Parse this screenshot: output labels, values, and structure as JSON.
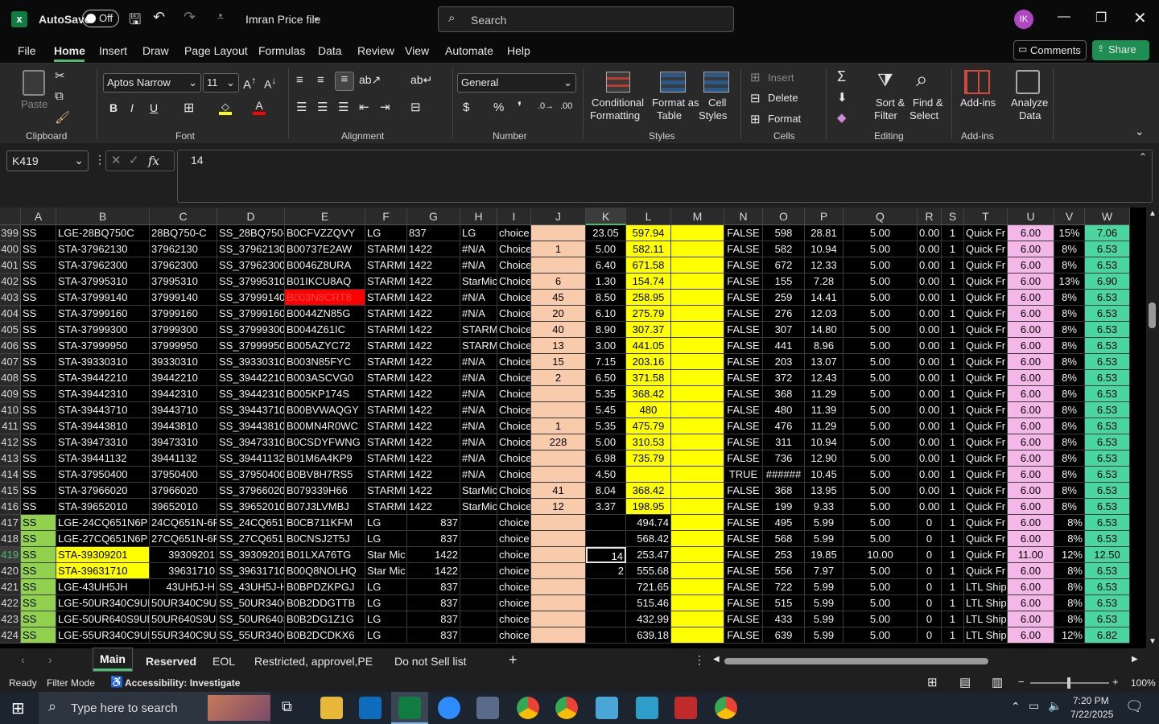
{
  "title_bar": {
    "autosave_label": "AutoSave",
    "autosave_state": "Off",
    "file_name": "Imran Price file",
    "search_placeholder": "Search",
    "avatar_initials": "IK"
  },
  "menu": {
    "items": [
      "File",
      "Home",
      "Insert",
      "Draw",
      "Page Layout",
      "Formulas",
      "Data",
      "Review",
      "View",
      "Automate",
      "Help"
    ],
    "active": "Home",
    "comments_label": "Comments",
    "share_label": "Share"
  },
  "ribbon": {
    "clipboard": {
      "paste": "Paste",
      "label": "Clipboard"
    },
    "font": {
      "name": "Aptos Narrow",
      "size": "11",
      "label": "Font"
    },
    "alignment": {
      "label": "Alignment"
    },
    "number": {
      "format": "General",
      "label": "Number"
    },
    "styles": {
      "conditional_1": "Conditional",
      "conditional_2": "Formatting",
      "format_table_1": "Format as",
      "format_table_2": "Table",
      "cell_styles_1": "Cell",
      "cell_styles_2": "Styles",
      "label": "Styles"
    },
    "cells": {
      "insert": "Insert",
      "delete": "Delete",
      "format": "Format",
      "label": "Cells"
    },
    "editing": {
      "sort_1": "Sort &",
      "sort_2": "Filter",
      "find_1": "Find &",
      "find_2": "Select",
      "label": "Editing"
    },
    "addins": {
      "addins": "Add-ins",
      "analyze_1": "Analyze",
      "analyze_2": "Data",
      "label": "Add-ins"
    }
  },
  "formula_bar": {
    "name_box": "K419",
    "fx": "fx",
    "value": "14"
  },
  "columns": [
    "A",
    "B",
    "C",
    "D",
    "E",
    "F",
    "G",
    "H",
    "I",
    "J",
    "K",
    "L",
    "M",
    "N",
    "O",
    "P",
    "Q",
    "R",
    "S",
    "T",
    "U",
    "V",
    "W"
  ],
  "rows": [
    {
      "n": "399",
      "A": "SS",
      "B": "LGE-28BQ750C",
      "C": "28BQ750-C",
      "D": "SS_28BQ750-C",
      "E": "B0CFVZZQVY",
      "F": "LG",
      "G": "837",
      "H": "LG",
      "I": "choice",
      "J": "",
      "K": "23.05",
      "L": "597.94",
      "M": "",
      "N": "FALSE",
      "O": "598",
      "P": "28.81",
      "Q": "5.00",
      "R": "0.00",
      "S": "1",
      "T": "Quick Fr",
      "U": "6.00",
      "V": "15%",
      "W": "7.06"
    },
    {
      "n": "400",
      "A": "SS",
      "B": "STA-37962130",
      "C": "37962130",
      "D": "SS_37962130",
      "E": "B00737E2AW",
      "F": "STARMI",
      "G": "1422",
      "H": "#N/A",
      "I": "Choice",
      "J": "1",
      "K": "5.00",
      "L": "582.11",
      "M": "",
      "N": "FALSE",
      "O": "582",
      "P": "10.94",
      "Q": "5.00",
      "R": "0.00",
      "S": "1",
      "T": "Quick Fr",
      "U": "6.00",
      "V": "8%",
      "W": "6.53"
    },
    {
      "n": "401",
      "A": "SS",
      "B": "STA-37962300",
      "C": "37962300",
      "D": "SS_37962300",
      "E": "B0046Z8URA",
      "F": "STARMI",
      "G": "1422",
      "H": "#N/A",
      "I": "Choice",
      "J": "",
      "K": "6.40",
      "L": "671.58",
      "M": "",
      "N": "FALSE",
      "O": "672",
      "P": "12.33",
      "Q": "5.00",
      "R": "0.00",
      "S": "1",
      "T": "Quick Fr",
      "U": "6.00",
      "V": "8%",
      "W": "6.53"
    },
    {
      "n": "402",
      "A": "SS",
      "B": "STA-37995310",
      "C": "37995310",
      "D": "SS_37995310",
      "E": "B01IKCU8AQ",
      "F": "STARMI",
      "G": "1422",
      "H": "StarMic",
      "I": "Choice",
      "J": "6",
      "K": "1.30",
      "L": "154.74",
      "M": "",
      "N": "FALSE",
      "O": "155",
      "P": "7.28",
      "Q": "5.00",
      "R": "0.00",
      "S": "1",
      "T": "Quick Fr",
      "U": "6.00",
      "V": "13%",
      "W": "6.90"
    },
    {
      "n": "403",
      "A": "SS",
      "B": "STA-37999140",
      "C": "37999140",
      "D": "SS_37999140",
      "E": "B003N8CRT8",
      "F": "STARMI",
      "G": "1422",
      "H": "#N/A",
      "I": "Choice",
      "J": "45",
      "K": "8.50",
      "L": "258.95",
      "M": "",
      "N": "FALSE",
      "O": "259",
      "P": "14.41",
      "Q": "5.00",
      "R": "0.00",
      "S": "1",
      "T": "Quick Fr",
      "U": "6.00",
      "V": "8%",
      "W": "6.53"
    },
    {
      "n": "404",
      "A": "SS",
      "B": "STA-37999160",
      "C": "37999160",
      "D": "SS_37999160",
      "E": "B0044ZN85G",
      "F": "STARMI",
      "G": "1422",
      "H": "#N/A",
      "I": "Choice",
      "J": "20",
      "K": "6.10",
      "L": "275.79",
      "M": "",
      "N": "FALSE",
      "O": "276",
      "P": "12.03",
      "Q": "5.00",
      "R": "0.00",
      "S": "1",
      "T": "Quick Fr",
      "U": "6.00",
      "V": "8%",
      "W": "6.53"
    },
    {
      "n": "405",
      "A": "SS",
      "B": "STA-37999300",
      "C": "37999300",
      "D": "SS_37999300",
      "E": "B0044Z61IC",
      "F": "STARMI",
      "G": "1422",
      "H": "STARM",
      "I": "Choice",
      "J": "40",
      "K": "8.90",
      "L": "307.37",
      "M": "",
      "N": "FALSE",
      "O": "307",
      "P": "14.80",
      "Q": "5.00",
      "R": "0.00",
      "S": "1",
      "T": "Quick Fr",
      "U": "6.00",
      "V": "8%",
      "W": "6.53"
    },
    {
      "n": "406",
      "A": "SS",
      "B": "STA-37999950",
      "C": "37999950",
      "D": "SS_37999950",
      "E": "B005AZYC72",
      "F": "STARMI",
      "G": "1422",
      "H": "STARM",
      "I": "Choice",
      "J": "13",
      "K": "3.00",
      "L": "441.05",
      "M": "",
      "N": "FALSE",
      "O": "441",
      "P": "8.96",
      "Q": "5.00",
      "R": "0.00",
      "S": "1",
      "T": "Quick Fr",
      "U": "6.00",
      "V": "8%",
      "W": "6.53"
    },
    {
      "n": "407",
      "A": "SS",
      "B": "STA-39330310",
      "C": "39330310",
      "D": "SS_39330310",
      "E": "B003N85FYC",
      "F": "STARMI",
      "G": "1422",
      "H": "#N/A",
      "I": "Choice",
      "J": "15",
      "K": "7.15",
      "L": "203.16",
      "M": "",
      "N": "FALSE",
      "O": "203",
      "P": "13.07",
      "Q": "5.00",
      "R": "0.00",
      "S": "1",
      "T": "Quick Fr",
      "U": "6.00",
      "V": "8%",
      "W": "6.53"
    },
    {
      "n": "408",
      "A": "SS",
      "B": "STA-39442210",
      "C": "39442210",
      "D": "SS_39442210",
      "E": "B003ASCVG0",
      "F": "STARMI",
      "G": "1422",
      "H": "#N/A",
      "I": "Choice",
      "J": "2",
      "K": "6.50",
      "L": "371.58",
      "M": "",
      "N": "FALSE",
      "O": "372",
      "P": "12.43",
      "Q": "5.00",
      "R": "0.00",
      "S": "1",
      "T": "Quick Fr",
      "U": "6.00",
      "V": "8%",
      "W": "6.53"
    },
    {
      "n": "409",
      "A": "SS",
      "B": "STA-39442310",
      "C": "39442310",
      "D": "SS_39442310",
      "E": "B005KP174S",
      "F": "STARMI",
      "G": "1422",
      "H": "#N/A",
      "I": "Choice",
      "J": "",
      "K": "5.35",
      "L": "368.42",
      "M": "",
      "N": "FALSE",
      "O": "368",
      "P": "11.29",
      "Q": "5.00",
      "R": "0.00",
      "S": "1",
      "T": "Quick Fr",
      "U": "6.00",
      "V": "8%",
      "W": "6.53"
    },
    {
      "n": "410",
      "A": "SS",
      "B": "STA-39443710",
      "C": "39443710",
      "D": "SS_39443710",
      "E": "B00BVWAQGY",
      "F": "STARMI",
      "G": "1422",
      "H": "#N/A",
      "I": "Choice",
      "J": "",
      "K": "5.45",
      "L": "480",
      "M": "",
      "N": "FALSE",
      "O": "480",
      "P": "11.39",
      "Q": "5.00",
      "R": "0.00",
      "S": "1",
      "T": "Quick Fr",
      "U": "6.00",
      "V": "8%",
      "W": "6.53"
    },
    {
      "n": "411",
      "A": "SS",
      "B": "STA-39443810",
      "C": "39443810",
      "D": "SS_39443810",
      "E": "B00MN4R0WC",
      "F": "STARMI",
      "G": "1422",
      "H": "#N/A",
      "I": "Choice",
      "J": "1",
      "K": "5.35",
      "L": "475.79",
      "M": "",
      "N": "FALSE",
      "O": "476",
      "P": "11.29",
      "Q": "5.00",
      "R": "0.00",
      "S": "1",
      "T": "Quick Fr",
      "U": "6.00",
      "V": "8%",
      "W": "6.53"
    },
    {
      "n": "412",
      "A": "SS",
      "B": "STA-39473310",
      "C": "39473310",
      "D": "SS_39473310",
      "E": "B0CSDYFWNG",
      "F": "STARMI",
      "G": "1422",
      "H": "#N/A",
      "I": "Choice",
      "J": "228",
      "K": "5.00",
      "L": "310.53",
      "M": "",
      "N": "FALSE",
      "O": "311",
      "P": "10.94",
      "Q": "5.00",
      "R": "0.00",
      "S": "1",
      "T": "Quick Fr",
      "U": "6.00",
      "V": "8%",
      "W": "6.53"
    },
    {
      "n": "413",
      "A": "SS",
      "B": "STA-39441132",
      "C": "39441132",
      "D": "SS_39441132",
      "E": "B01M6A4KP9",
      "F": "STARMI",
      "G": "1422",
      "H": "#N/A",
      "I": "Choice",
      "J": "",
      "K": "6.98",
      "L": "735.79",
      "M": "",
      "N": "FALSE",
      "O": "736",
      "P": "12.90",
      "Q": "5.00",
      "R": "0.00",
      "S": "1",
      "T": "Quick Fr",
      "U": "6.00",
      "V": "8%",
      "W": "6.53"
    },
    {
      "n": "414",
      "A": "SS",
      "B": "STA-37950400",
      "C": "37950400",
      "D": "SS_37950400",
      "E": "B0BV8H7RS5",
      "F": "STARMI",
      "G": "1422",
      "H": "#N/A",
      "I": "Choice",
      "J": "",
      "K": "4.50",
      "L": "",
      "M": "",
      "N": "TRUE",
      "O": "######",
      "P": "10.45",
      "Q": "5.00",
      "R": "0.00",
      "S": "1",
      "T": "Quick Fr",
      "U": "6.00",
      "V": "8%",
      "W": "6.53"
    },
    {
      "n": "415",
      "A": "SS",
      "B": "STA-37966020",
      "C": "37966020",
      "D": "SS_37966020",
      "E": "B079339H66",
      "F": "STARMI",
      "G": "1422",
      "H": "StarMic",
      "I": "Choice",
      "J": "41",
      "K": "8.04",
      "L": "368.42",
      "M": "",
      "N": "FALSE",
      "O": "368",
      "P": "13.95",
      "Q": "5.00",
      "R": "0.00",
      "S": "1",
      "T": "Quick Fr",
      "U": "6.00",
      "V": "8%",
      "W": "6.53"
    },
    {
      "n": "416",
      "A": "SS",
      "B": "STA-39652010",
      "C": "39652010",
      "D": "SS_39652010",
      "E": "B07J3LVMBJ",
      "F": "STARMI",
      "G": "1422",
      "H": "StarMic",
      "I": "Choice",
      "J": "12",
      "K": "3.37",
      "L": "198.95",
      "M": "",
      "N": "FALSE",
      "O": "199",
      "P": "9.33",
      "Q": "5.00",
      "R": "0.00",
      "S": "1",
      "T": "Quick Fr",
      "U": "6.00",
      "V": "8%",
      "W": "6.53"
    },
    {
      "n": "417",
      "A": "SS",
      "B": "LGE-24CQ651N6P",
      "C": "24CQ651N-6F",
      "D": "SS_24CQ651N",
      "E": "B0CB711KFM",
      "F": "LG",
      "G": "837",
      "H": "",
      "I": "choice",
      "J": "",
      "K": "",
      "L": "494.74",
      "M": "",
      "N": "FALSE",
      "O": "495",
      "P": "5.99",
      "Q": "5.00",
      "R": "0",
      "S": "1",
      "T": "Quick Fr",
      "U": "6.00",
      "V": "8%",
      "W": "6.53"
    },
    {
      "n": "418",
      "A": "SS",
      "B": "LGE-27CQ651N6P",
      "C": "27CQ651N-6F",
      "D": "SS_27CQ651N",
      "E": "B0CNSJ2T5J",
      "F": "LG",
      "G": "837",
      "H": "",
      "I": "choice",
      "J": "",
      "K": "",
      "L": "568.42",
      "M": "",
      "N": "FALSE",
      "O": "568",
      "P": "5.99",
      "Q": "5.00",
      "R": "0",
      "S": "1",
      "T": "Quick Fr",
      "U": "6.00",
      "V": "8%",
      "W": "6.53"
    },
    {
      "n": "419",
      "A": "SS",
      "B": "STA-39309201",
      "C": "39309201",
      "D": "SS_39309201",
      "E": "B01LXA76TG",
      "F": "Star Mic",
      "G": "1422",
      "H": "",
      "I": "choice",
      "J": "",
      "K": "14",
      "L": "253.47",
      "M": "",
      "N": "FALSE",
      "O": "253",
      "P": "19.85",
      "Q": "10.00",
      "R": "0",
      "S": "1",
      "T": "Quick Fr",
      "U": "11.00",
      "V": "12%",
      "W": "12.50"
    },
    {
      "n": "420",
      "A": "SS",
      "B": "STA-39631710",
      "C": "39631710",
      "D": "SS_39631710",
      "E": "B00Q8NOLHQ",
      "F": "Star Mic",
      "G": "1422",
      "H": "",
      "I": "choice",
      "J": "",
      "K": "2",
      "L": "555.68",
      "M": "",
      "N": "FALSE",
      "O": "556",
      "P": "7.97",
      "Q": "5.00",
      "R": "0",
      "S": "1",
      "T": "Quick Fr",
      "U": "6.00",
      "V": "8%",
      "W": "6.53"
    },
    {
      "n": "421",
      "A": "SS",
      "B": "LGE-43UH5JH",
      "C": "43UH5J-H",
      "D": "SS_43UH5J-H",
      "E": "B0BPDZKPGJ",
      "F": "LG",
      "G": "837",
      "H": "",
      "I": "choice",
      "J": "",
      "K": "",
      "L": "721.65",
      "M": "",
      "N": "FALSE",
      "O": "722",
      "P": "5.99",
      "Q": "5.00",
      "R": "0",
      "S": "1",
      "T": "LTL Ship",
      "U": "6.00",
      "V": "8%",
      "W": "6.53"
    },
    {
      "n": "422",
      "A": "SS",
      "B": "LGE-50UR340C9UD",
      "C": "50UR340C9UI",
      "D": "SS_50UR340C",
      "E": "B0B2DDGTTB",
      "F": "LG",
      "G": "837",
      "H": "",
      "I": "choice",
      "J": "",
      "K": "",
      "L": "515.46",
      "M": "",
      "N": "FALSE",
      "O": "515",
      "P": "5.99",
      "Q": "5.00",
      "R": "0",
      "S": "1",
      "T": "LTL Ship",
      "U": "6.00",
      "V": "8%",
      "W": "6.53"
    },
    {
      "n": "423",
      "A": "SS",
      "B": "LGE-50UR640S9UD",
      "C": "50UR640S9UI",
      "D": "SS_50UR640S",
      "E": "B0B2DG1Z1G",
      "F": "LG",
      "G": "837",
      "H": "",
      "I": "choice",
      "J": "",
      "K": "",
      "L": "432.99",
      "M": "",
      "N": "FALSE",
      "O": "433",
      "P": "5.99",
      "Q": "5.00",
      "R": "0",
      "S": "1",
      "T": "LTL Ship",
      "U": "6.00",
      "V": "8%",
      "W": "6.53"
    },
    {
      "n": "424",
      "A": "SS",
      "B": "LGE-55UR340C9UD",
      "C": "55UR340C9UI",
      "D": "SS_55UR340C",
      "E": "B0B2DCDKX6",
      "F": "LG",
      "G": "837",
      "H": "",
      "I": "choice",
      "J": "",
      "K": "",
      "L": "639.18",
      "M": "",
      "N": "FALSE",
      "O": "639",
      "P": "5.99",
      "Q": "5.00",
      "R": "0",
      "S": "1",
      "T": "LTL Ship",
      "U": "6.00",
      "V": "12%",
      "W": "6.82"
    }
  ],
  "sheets": {
    "tabs": [
      "Main",
      "Reserved",
      "EOL",
      "Restricted, approvel,PE",
      "Do not Sell list"
    ],
    "active": "Main"
  },
  "status": {
    "ready": "Ready",
    "filter_mode": "Filter Mode",
    "accessibility": "Accessibility: Investigate",
    "zoom": "100%"
  },
  "taskbar": {
    "search_placeholder": "Type here to search",
    "time": "7:20 PM",
    "date": "7/22/2025"
  },
  "colors": {
    "excel_green": "#107c41",
    "peach": "#f8cbad",
    "yellow": "#ffff00",
    "light_green": "#92d050",
    "pink": "#f4b8e8",
    "aqua": "#4ad6a0",
    "red": "#ff0000"
  }
}
